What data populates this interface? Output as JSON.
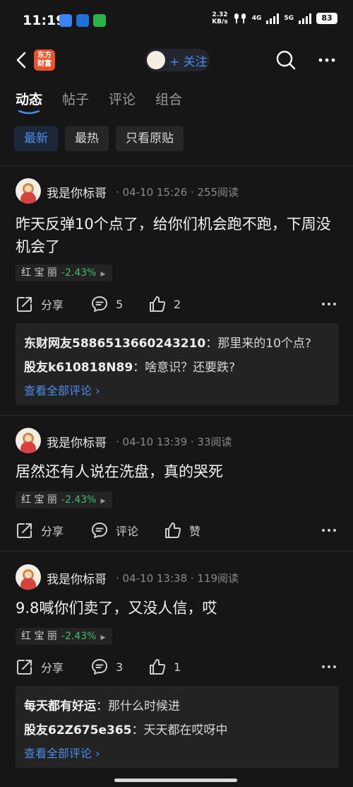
{
  "status": {
    "time": "11:19",
    "speed_top": "2.32",
    "speed_bottom": "KB/s",
    "net1": "4G",
    "net2": "5G",
    "battery": "83",
    "apps": [
      {
        "icon": "weather-app-icon",
        "color": "#3b82f6"
      },
      {
        "icon": "outlook-app-icon",
        "color": "#1f6fd6"
      },
      {
        "icon": "wechat-app-icon",
        "color": "#2bb34a"
      }
    ]
  },
  "header": {
    "logo": "东方\n财富",
    "follow": "+ 关注"
  },
  "tabs": [
    "动态",
    "帖子",
    "评论",
    "组合"
  ],
  "filters": [
    "最新",
    "最热",
    "只看原贴"
  ],
  "posts": [
    {
      "author": "我是你标哥",
      "meta": "· 04-10 15:26 · 255阅读",
      "content": "昨天反弹10个点了，给你们机会跑不跑，下周没机会了",
      "stock": {
        "name": "红 宝 丽",
        "change": "-2.43%"
      },
      "share": "分享",
      "comment_count": "5",
      "like_count": "2",
      "comments": [
        {
          "user": "东财网友5886513660243210",
          "text": "那里来的10个点?"
        },
        {
          "user": "股友k610818N89",
          "text": "啥意识？还要跌?"
        }
      ],
      "view_all": "查看全部评论 ›"
    },
    {
      "author": "我是你标哥",
      "meta": "· 04-10 13:39 · 33阅读",
      "content": "居然还有人说在洗盘，真的哭死",
      "stock": {
        "name": "红 宝 丽",
        "change": "-2.43%"
      },
      "share": "分享",
      "comment_label": "评论",
      "like_label": "赞"
    },
    {
      "author": "我是你标哥",
      "meta": "· 04-10 13:38 · 119阅读",
      "content": "9.8喊你们卖了，又没人信，哎",
      "stock": {
        "name": "红 宝 丽",
        "change": "-2.43%"
      },
      "share": "分享",
      "comment_count": "3",
      "like_count": "1",
      "comments": [
        {
          "user": "每天都有好运",
          "text": "那什么时候进"
        },
        {
          "user": "股友62Z675e365",
          "text": "天天都在哎呀中"
        }
      ],
      "view_all": "查看全部评论 ›"
    }
  ],
  "colors": {
    "accent": "#4c8cf0",
    "down": "#3fbf6a",
    "logo": "#e8542a"
  }
}
